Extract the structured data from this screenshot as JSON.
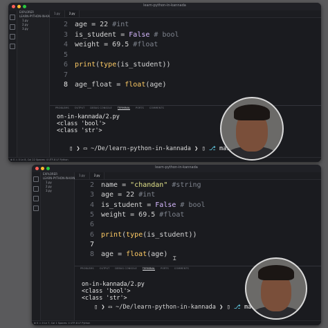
{
  "top": {
    "window_title": "learn-python-in-kannada",
    "explorer_header": "EXPLORER",
    "explorer_items": [
      "LEARN-PYTHON-IN-KANNADA",
      "1.py",
      "2.py",
      "3.py"
    ],
    "tabs": [
      "1.py",
      "2.py"
    ],
    "code_lines": [
      {
        "num": "2",
        "text": "age = 22 #int"
      },
      {
        "num": "3",
        "text": "is_student = False # bool"
      },
      {
        "num": "4",
        "text": "weight = 69.5 #float"
      },
      {
        "num": "5",
        "text": ""
      },
      {
        "num": "6",
        "text": "print(type(is_student))"
      },
      {
        "num": "7",
        "text": ""
      },
      {
        "num": "8",
        "text": "age_float = float(age)"
      }
    ],
    "panel_tabs": [
      "PROBLEMS",
      "OUTPUT",
      "DEBUG CONSOLE",
      "TERMINAL",
      "PORTS",
      "COMMENTS"
    ],
    "terminal_lines": [
      "on-in-kannada/2.py",
      "<class 'bool'>",
      "<class 'str'>"
    ],
    "prompt": {
      "dir": "~/De/learn-python-in-kannada",
      "branch": "main"
    },
    "status": "⊗ 0 ⚠ 0   Ln 8, Col 22   Spaces: 4   UTF-8   LF   Python"
  },
  "bottom": {
    "window_title": "learn-python-in-kannada",
    "explorer_header": "EXPLORER",
    "explorer_items": [
      "LEARN-PYTHON-IN-KANNADA",
      "1.py",
      "2.py",
      "3.py"
    ],
    "tabs": [
      "1.py",
      "2.py"
    ],
    "code_lines": [
      {
        "num": "2",
        "text": "name = \"chandan\" #string"
      },
      {
        "num": "3",
        "text": "age = 22 #int"
      },
      {
        "num": "4",
        "text": "is_student = False # bool"
      },
      {
        "num": "5",
        "text": "weight = 69.5 #float"
      },
      {
        "num": "6",
        "text": ""
      },
      {
        "num": "6",
        "text": "print(type(is_student))"
      },
      {
        "num": "7",
        "text": ""
      },
      {
        "num": "8",
        "text": "age = float(age)"
      }
    ],
    "panel_tabs": [
      "PROBLEMS",
      "OUTPUT",
      "DEBUG CONSOLE",
      "TERMINAL",
      "PORTS",
      "COMMENTS"
    ],
    "terminal_lines": [
      "on-in-kannada/2.py",
      "<class 'bool'>",
      "<class 'str'>"
    ],
    "prompt": {
      "dir": "~/De/learn-python-in-kannada",
      "branch": "main"
    },
    "status": "⊗ 0 ⚠ 0   Ln 7, Col 1   Spaces: 4   UTF-8   LF   Python"
  },
  "colors": {
    "keyword": "#d7b9ff",
    "func": "#ffcc66",
    "string": "#e2e28a",
    "comment": "#7f848e",
    "number": "#d6d6d6"
  }
}
